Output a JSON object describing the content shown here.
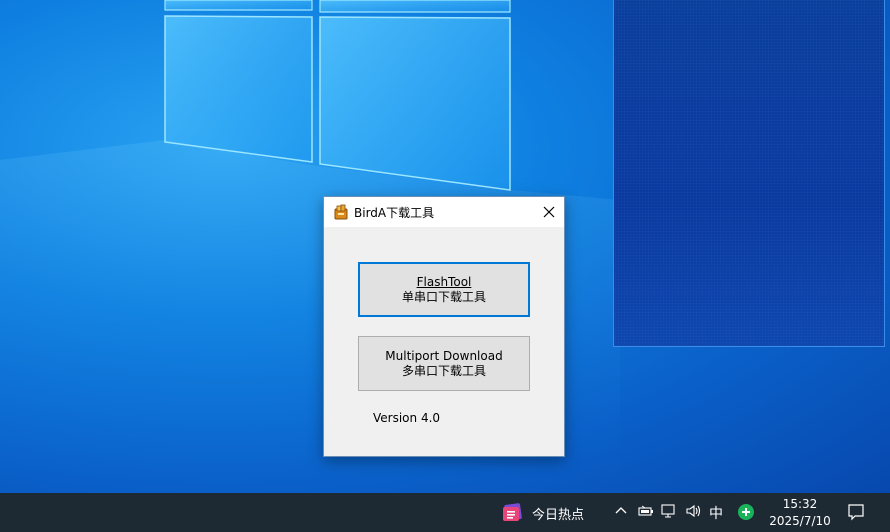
{
  "dialog": {
    "title": "BirdA下载工具",
    "icon": "birda-app-icon",
    "close_icon": "close-icon",
    "flash_button": {
      "line1": "FlashTool",
      "line2": "单串口下载工具"
    },
    "multiport_button": {
      "line1": "Multiport Download",
      "line2": "多串口下载工具"
    },
    "version": "Version 4.0"
  },
  "taskbar": {
    "news_label": "今日热点",
    "ime_label": "中",
    "time": "15:32",
    "date": "2025/7/10",
    "tray_icons": [
      "chevron-up-icon",
      "battery-icon",
      "network-icon",
      "volume-icon",
      "green-app-icon",
      "notification-icon"
    ]
  },
  "colors": {
    "accent": "#0078d7",
    "taskbar_bg": "#1e2a33",
    "desktop_blue": "#0e7fe0"
  }
}
